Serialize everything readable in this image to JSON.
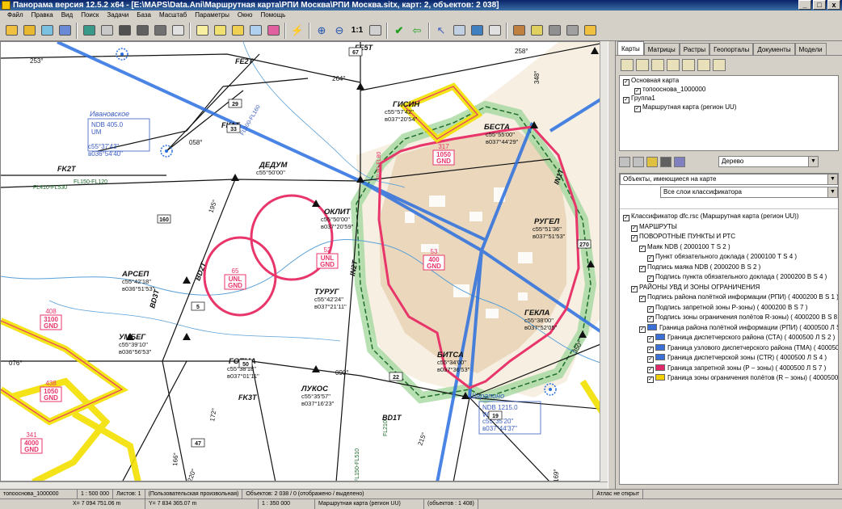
{
  "window": {
    "title": "Панорама версия 12.5.2 x64 - [E:\\MAPS\\Data.Ani\\Маршрутная карта\\РПИ Москва\\РПИ Москва.sitx, карт: 2, объектов: 2 038]",
    "min": "_",
    "max": "□",
    "close": "x"
  },
  "menu": [
    "Файл",
    "Правка",
    "Вид",
    "Поиск",
    "Задачи",
    "База",
    "Масштаб",
    "Параметры",
    "Окно",
    "Помощь"
  ],
  "toolbar": {
    "zoom_label": "1:1"
  },
  "panel": {
    "tabs": [
      "Карты",
      "Матрицы",
      "Растры",
      "Геопорталы",
      "Документы",
      "Модели"
    ],
    "layers": [
      {
        "label": "Основная карта",
        "indent": 0
      },
      {
        "label": "топооснова_1000000",
        "indent": 1
      },
      {
        "label": "Группа1",
        "indent": 0
      },
      {
        "label": "Маршрутная карта (регион UU)",
        "indent": 1
      }
    ],
    "view_combo": "Дерево",
    "objects_combo": "Объекты, имеющиеся на карте",
    "layers_combo": "Все слои классификатора",
    "tree": [
      {
        "label": "Классификатор dfc.rsc (Маршрутная карта (регион UU))",
        "indent": 0,
        "swatch": ""
      },
      {
        "label": "МАРШРУТЫ",
        "indent": 1,
        "swatch": ""
      },
      {
        "label": "ПОВОРОТНЫЕ ПУНКТЫ И РТС",
        "indent": 1,
        "swatch": ""
      },
      {
        "label": "Маяк NDB ( 2000100 Т S 2 )",
        "indent": 2,
        "swatch": ""
      },
      {
        "label": "Пункт обязательного доклада ( 2000100 Т S 4 )",
        "indent": 3,
        "swatch": ""
      },
      {
        "label": "Подпись маяка NDB ( 2000200 В S 2 )",
        "indent": 2,
        "swatch": ""
      },
      {
        "label": "Подпись пункта обязательного доклада ( 2000200 В S 4 )",
        "indent": 3,
        "swatch": ""
      },
      {
        "label": "РАЙОНЫ УВД И ЗОНЫ ОГРАНИЧЕНИЯ",
        "indent": 1,
        "swatch": ""
      },
      {
        "label": "Подпись района полётной информации (РПИ) ( 4000200 В S 1 )",
        "indent": 2,
        "swatch": ""
      },
      {
        "label": "Подпись запретной зоны P-зоны) ( 4000200 В S 7 )",
        "indent": 3,
        "swatch": ""
      },
      {
        "label": "Подпись зоны ограничения полётов R-зоны) ( 4000200 В S 8 )",
        "indent": 3,
        "swatch": ""
      },
      {
        "label": "Граница района полётной информации (РПИ) ( 4000500 Л S 1 )",
        "indent": 2,
        "swatch": "#3a6fd8"
      },
      {
        "label": "Граница диспетчерского района (СТА) ( 4000500 Л S 2 )",
        "indent": 3,
        "swatch": "#3a6fd8"
      },
      {
        "label": "Граница узлового диспетчерского района (ТМА) ( 4000500 Л S 3 )",
        "indent": 3,
        "swatch": "#3a6fd8"
      },
      {
        "label": "Граница диспетчерской зоны (CTR) ( 4000500 Л S 4 )",
        "indent": 3,
        "swatch": "#3a6fd8"
      },
      {
        "label": "Граница запретной зоны (Р – зоны) ( 4000500 Л S 7 )",
        "indent": 3,
        "swatch": "#e0286a"
      },
      {
        "label": "Граница зоны ограничения полётов (R – зоны) ( 4000500 Л S 8 )",
        "indent": 3,
        "swatch": "#f0d000"
      }
    ]
  },
  "map": {
    "points": [
      {
        "name": "ГИСИН",
        "coord": "с55°57'42\"|в037°20'54\""
      },
      {
        "name": "БЕСТА",
        "coord": "с55°55'00\"|в037°44'29\""
      },
      {
        "name": "ДЕДУМ",
        "coord": "с55°50'00\""
      },
      {
        "name": "ОКЛИТ",
        "coord": "с55°50'00\"|в037°20'59\""
      },
      {
        "name": "РУГЕЛ",
        "coord": "с55°51'36\"|в037°51'53\""
      },
      {
        "name": "АРСЕП",
        "coord": "с55°42'18\"|в036°51'53\""
      },
      {
        "name": "ТУРУГ",
        "coord": "с55°42'24\"|в037°21'11\""
      },
      {
        "name": "УМБЕГ",
        "coord": "с55°39'10\"|в036°56'53\""
      },
      {
        "name": "ГОТМА",
        "coord": "с55°38'18\"|в037°01'11\""
      },
      {
        "name": "ГЕКЛА",
        "coord": "с55°38'00\"|в037°52'05\""
      },
      {
        "name": "БИТСА",
        "coord": "с55°34'00\"|в037°36'53\""
      },
      {
        "name": "ЛУКОС",
        "coord": "с55°35'57\"|в037°16'23\""
      }
    ],
    "airways": [
      "FE2T",
      "FE5T",
      "FK1T",
      "FK2T",
      "FK3T",
      "BD1T",
      "BD2T",
      "BD3T",
      "IN1T",
      "IN2T"
    ],
    "ndb": [
      {
        "name": "Ивановское",
        "info": "NDB 405.0|UM",
        "coord": "с55°37'43\"|в036°54'40\""
      },
      {
        "name": "Шарапино",
        "info": "NDB 1215.0|WT",
        "coord": "с55°35'20\"|в037°44'37\""
      }
    ],
    "zones": [
      {
        "num": "317",
        "alt": "1050",
        "base": "GND"
      },
      {
        "num": "52",
        "alt": "UNL",
        "base": "GND"
      },
      {
        "num": "65",
        "alt": "UNL",
        "base": "GND"
      },
      {
        "num": "53",
        "alt": "400",
        "base": "GND"
      },
      {
        "num": "408",
        "alt": "3100",
        "base": "GND"
      },
      {
        "num": "438",
        "alt": "1050",
        "base": "GND"
      },
      {
        "num": "341",
        "alt": "4000",
        "base": "GND"
      }
    ],
    "flight_levels": [
      "FL410-FL530",
      "FL300-FL160",
      "FL150-FL120",
      "FL90-FL80",
      "FL150-FL510",
      "FL210"
    ],
    "bearings": [
      "253°",
      "264°",
      "258°",
      "348°",
      "058°",
      "195°",
      "090°",
      "076°",
      "172°",
      "166°",
      "350°",
      "215°",
      "169°",
      "220°"
    ],
    "mag_labels": [
      "29",
      "33",
      "22",
      "50",
      "47",
      "19",
      "67",
      "5",
      "160",
      "270"
    ]
  },
  "status": {
    "row1": [
      "топооснова_1000000",
      "1 : 500 000",
      "Листов: 1",
      "(Пользовательская произвольная)",
      "Объектов: 2 038 / 0 (отображено / выделено)",
      "Атлас не открыт"
    ],
    "row2": [
      "X= 7 094 751.06 m",
      "Y= 7 834 365.07 m",
      "1 : 350 000",
      "Маршрутная карта (регион UU)",
      "(объектов : 1 408)"
    ]
  },
  "colors": {
    "route_blue": "#2a6fe0",
    "zone_red": "#e8356a",
    "fir_green": "#3aa04a",
    "yellow": "#f2e000"
  }
}
